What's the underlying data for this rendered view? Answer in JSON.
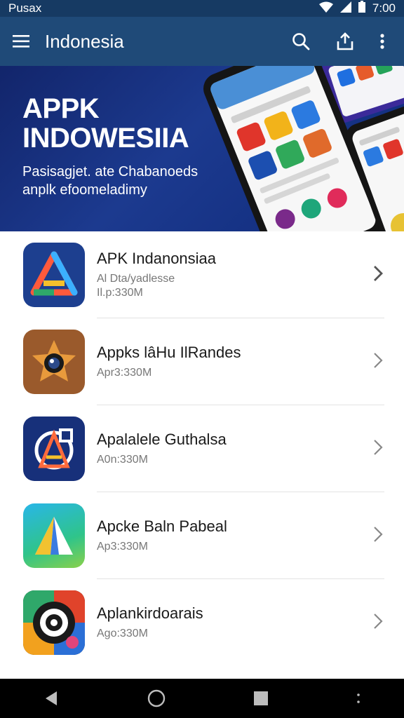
{
  "status": {
    "carrier": "Pusax",
    "time": "7:00"
  },
  "appbar": {
    "title": "Indonesia"
  },
  "banner": {
    "title_line1": "APPK",
    "title_line2": "INDOWESIIA",
    "subtitle_line1": "Pasisagjet. ate Chabanoeds",
    "subtitle_line2": "anplk efoomeladimy"
  },
  "apps": [
    {
      "name": "APK Indanonsiaa",
      "line1": "Al Dta/yadlesse",
      "line2": "Il.p:330M"
    },
    {
      "name": "Appks lâHu IlRandes",
      "line1": "Apr3:330M",
      "line2": ""
    },
    {
      "name": "Apalalele Guthalsa",
      "line1": "A0n:330M",
      "line2": ""
    },
    {
      "name": "Apcke Baln Pabeal",
      "line1": "Ap3:330M",
      "line2": ""
    },
    {
      "name": "Aplankirdoarais",
      "line1": "Ago:330M",
      "line2": ""
    }
  ]
}
